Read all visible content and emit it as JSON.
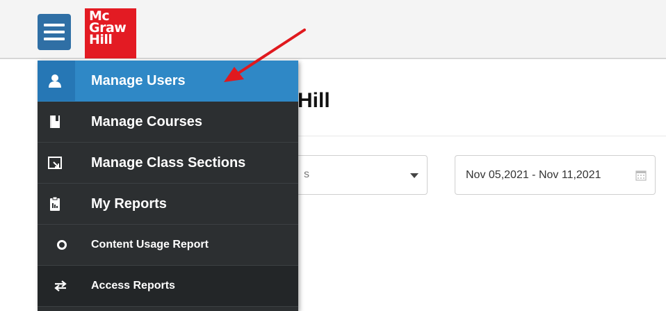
{
  "brand": {
    "logo_line1": "Mc",
    "logo_line2": "Graw",
    "logo_line3": "Hill",
    "logo_color": "#e31b23",
    "accent_color": "#2f88c6"
  },
  "header": {
    "menu_icon": "hamburger-icon"
  },
  "main": {
    "page_title_fragment": "Hill",
    "select_value_fragment": "s",
    "date_range": "Nov 05,2021 - Nov 11,2021",
    "date_icon": "calendar-icon"
  },
  "menu": {
    "items": [
      {
        "label": "Manage Users",
        "icon": "user-icon",
        "active": true
      },
      {
        "label": "Manage Courses",
        "icon": "book-icon",
        "active": false
      },
      {
        "label": "Manage Class Sections",
        "icon": "section-icon",
        "active": false
      },
      {
        "label": "My Reports",
        "icon": "clipboard-report-icon",
        "active": false
      },
      {
        "label": "Content Usage Report",
        "icon": "ring-icon",
        "active": false
      },
      {
        "label": "Access Reports",
        "icon": "exchange-arrows-icon",
        "active": false
      }
    ]
  },
  "annotation": {
    "arrow_color": "#e0191e",
    "arrow_icon": "red-arrow"
  }
}
